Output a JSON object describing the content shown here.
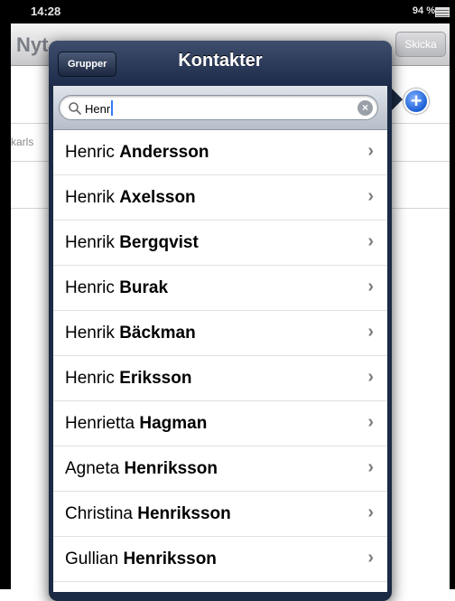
{
  "status_bar": {
    "time": "14:28",
    "battery": "94 %"
  },
  "background_app": {
    "title": "Nyt",
    "send_label": "Skicka",
    "field_fragment": "karls"
  },
  "popover": {
    "groups_label": "Grupper",
    "title": "Kontakter",
    "search_value": "Henr",
    "contacts": [
      {
        "first": "Henric",
        "last": "Andersson"
      },
      {
        "first": "Henrik",
        "last": "Axelsson"
      },
      {
        "first": "Henrik",
        "last": "Bergqvist"
      },
      {
        "first": "Henric",
        "last": "Burak"
      },
      {
        "first": "Henrik",
        "last": "Bäckman"
      },
      {
        "first": "Henric",
        "last": "Eriksson"
      },
      {
        "first": "Henrietta",
        "last": "Hagman"
      },
      {
        "first": "Agneta",
        "last": "Henriksson"
      },
      {
        "first": "Christina",
        "last": "Henriksson"
      },
      {
        "first": "Gullian",
        "last": "Henriksson"
      }
    ]
  },
  "colors": {
    "popover_bg": "#1b2a45",
    "accent_blue": "#1d5fd6"
  }
}
